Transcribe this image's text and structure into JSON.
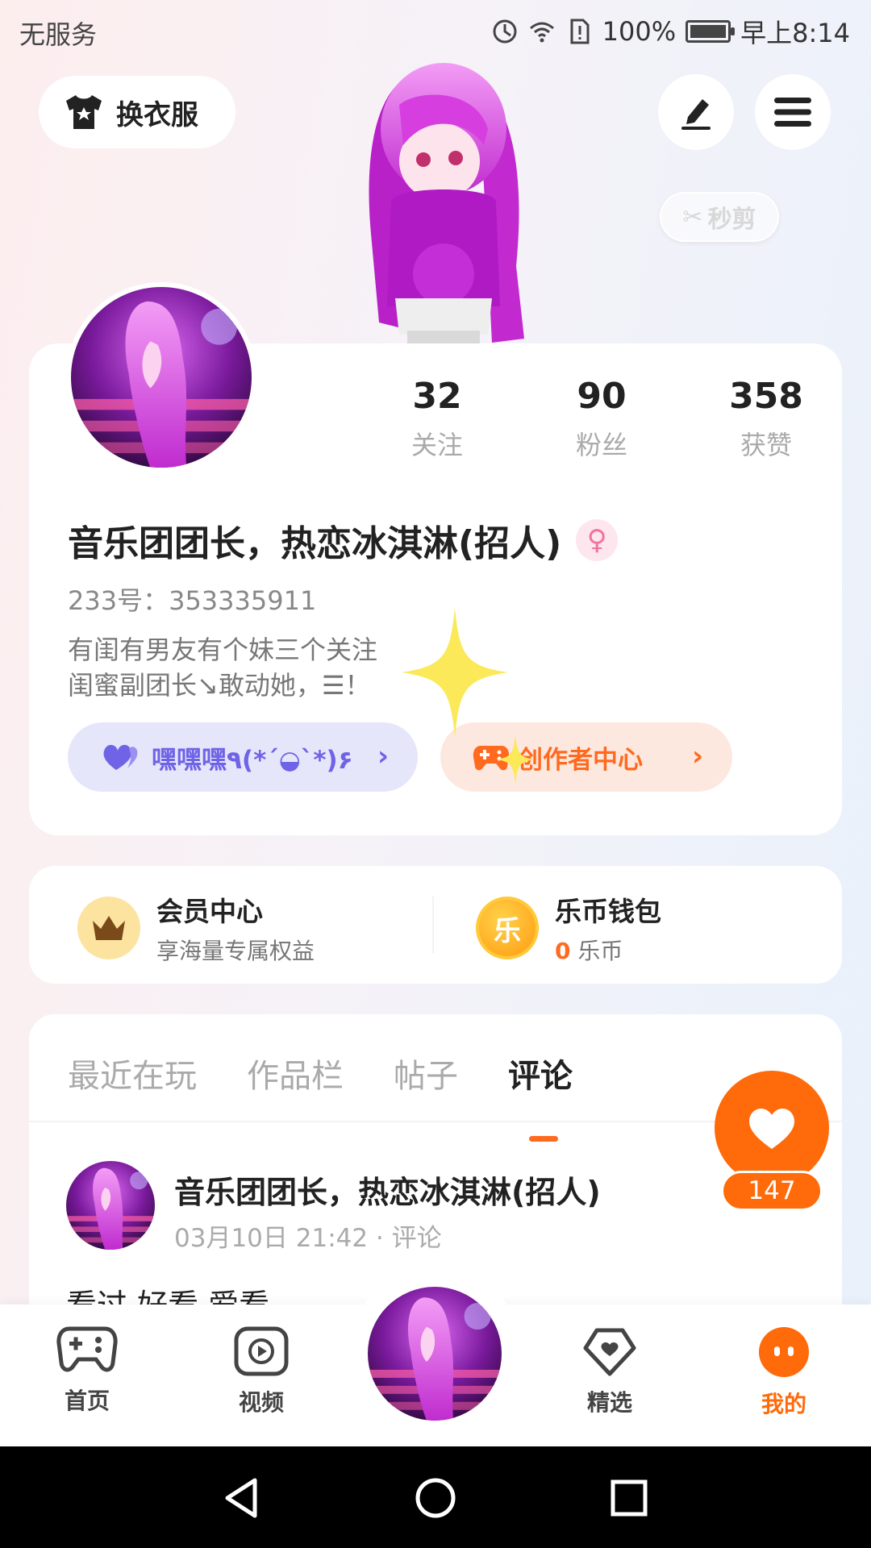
{
  "status_bar": {
    "carrier": "无服务",
    "battery": "100%",
    "time": "早上8:14",
    "battery_level": 1.0
  },
  "header": {
    "outfit_label": "换衣服",
    "clip_label": "秒剪"
  },
  "profile": {
    "stats": [
      {
        "value": "32",
        "label": "关注"
      },
      {
        "value": "90",
        "label": "粉丝"
      },
      {
        "value": "358",
        "label": "获赞"
      }
    ],
    "nickname": "音乐团团长，热恋冰淇淋(招人)",
    "gender_symbol": "♀",
    "user_id": "233号：353335911",
    "bio_line1": "有闺有男友有个妹三个关注",
    "bio_line2": "闺蜜副团长↘敢动她，☰！",
    "club_chip": "嘿嘿嘿٩(*´◒`*)۶",
    "creator_chip": "创作者中心"
  },
  "vip": {
    "member_title": "会员中心",
    "member_sub": "享海量专属权益",
    "wallet_title": "乐币钱包",
    "wallet_amount": "0",
    "wallet_unit": "乐币",
    "coin_glyph": "乐"
  },
  "tabs": [
    "最近在玩",
    "作品栏",
    "帖子",
    "评论"
  ],
  "active_tab": "评论",
  "comment": {
    "author": "音乐团团长，热恋冰淇淋(招人)",
    "meta": "03月10日 21:42 · 评论",
    "text": "看过   好看   爱看"
  },
  "like_count": "147",
  "bottom_nav": [
    {
      "label": "首页",
      "icon": "gamepad-icon"
    },
    {
      "label": "视频",
      "icon": "video-play-icon"
    },
    {
      "label": "精选",
      "icon": "heart-badge-icon"
    },
    {
      "label": "我的",
      "icon": "mine-face-icon",
      "active": true
    }
  ],
  "colors": {
    "accent": "#ff6a0a",
    "club_purple": "#6f63e6",
    "avatar_magenta": "#b21fd0"
  }
}
